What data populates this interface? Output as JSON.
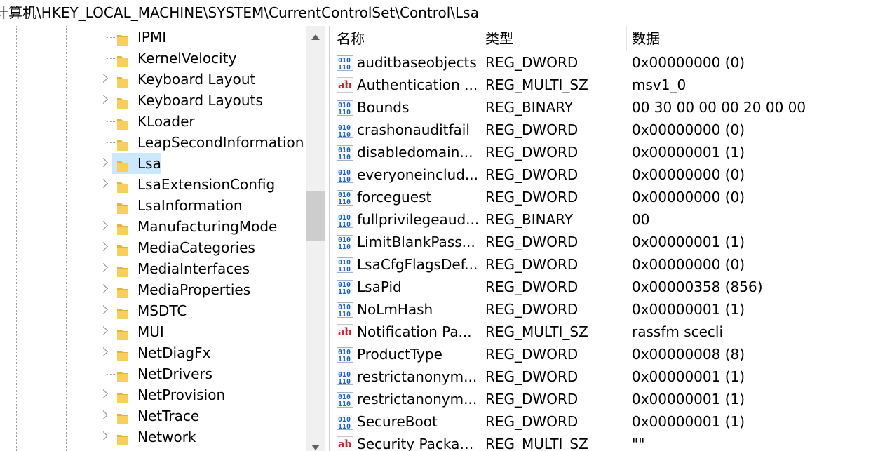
{
  "address": {
    "path": "计算机\\HKEY_LOCAL_MACHINE\\SYSTEM\\CurrentControlSet\\Control\\Lsa"
  },
  "tree": {
    "items": [
      {
        "label": "IPMI",
        "expandable": false,
        "selected": false
      },
      {
        "label": "KernelVelocity",
        "expandable": false,
        "selected": false
      },
      {
        "label": "Keyboard Layout",
        "expandable": true,
        "selected": false
      },
      {
        "label": "Keyboard Layouts",
        "expandable": true,
        "selected": false
      },
      {
        "label": "KLoader",
        "expandable": false,
        "selected": false
      },
      {
        "label": "LeapSecondInformation",
        "expandable": false,
        "selected": false
      },
      {
        "label": "Lsa",
        "expandable": true,
        "selected": true
      },
      {
        "label": "LsaExtensionConfig",
        "expandable": true,
        "selected": false
      },
      {
        "label": "LsaInformation",
        "expandable": false,
        "selected": false
      },
      {
        "label": "ManufacturingMode",
        "expandable": true,
        "selected": false
      },
      {
        "label": "MediaCategories",
        "expandable": true,
        "selected": false
      },
      {
        "label": "MediaInterfaces",
        "expandable": true,
        "selected": false
      },
      {
        "label": "MediaProperties",
        "expandable": true,
        "selected": false
      },
      {
        "label": "MSDTC",
        "expandable": true,
        "selected": false
      },
      {
        "label": "MUI",
        "expandable": true,
        "selected": false
      },
      {
        "label": "NetDiagFx",
        "expandable": true,
        "selected": false
      },
      {
        "label": "NetDrivers",
        "expandable": false,
        "selected": false
      },
      {
        "label": "NetProvision",
        "expandable": true,
        "selected": false
      },
      {
        "label": "NetTrace",
        "expandable": true,
        "selected": false
      },
      {
        "label": "Network",
        "expandable": true,
        "selected": false
      }
    ]
  },
  "list": {
    "columns": [
      "名称",
      "类型",
      "数据"
    ],
    "rows": [
      {
        "icon": "binary-value-icon",
        "name": "auditbaseobjects",
        "type": "REG_DWORD",
        "data": "0x00000000 (0)"
      },
      {
        "icon": "string-value-icon",
        "name": "Authentication ...",
        "type": "REG_MULTI_SZ",
        "data": "msv1_0"
      },
      {
        "icon": "binary-value-icon",
        "name": "Bounds",
        "type": "REG_BINARY",
        "data": "00 30 00 00 00 20 00 00"
      },
      {
        "icon": "binary-value-icon",
        "name": "crashonauditfail",
        "type": "REG_DWORD",
        "data": "0x00000000 (0)"
      },
      {
        "icon": "binary-value-icon",
        "name": "disabledomain...",
        "type": "REG_DWORD",
        "data": "0x00000001 (1)"
      },
      {
        "icon": "binary-value-icon",
        "name": "everyoneinclud...",
        "type": "REG_DWORD",
        "data": "0x00000000 (0)"
      },
      {
        "icon": "binary-value-icon",
        "name": "forceguest",
        "type": "REG_DWORD",
        "data": "0x00000000 (0)"
      },
      {
        "icon": "binary-value-icon",
        "name": "fullprivilegeaud...",
        "type": "REG_BINARY",
        "data": "00"
      },
      {
        "icon": "binary-value-icon",
        "name": "LimitBlankPass...",
        "type": "REG_DWORD",
        "data": "0x00000001 (1)"
      },
      {
        "icon": "binary-value-icon",
        "name": "LsaCfgFlagsDef...",
        "type": "REG_DWORD",
        "data": "0x00000000 (0)"
      },
      {
        "icon": "binary-value-icon",
        "name": "LsaPid",
        "type": "REG_DWORD",
        "data": "0x00000358 (856)"
      },
      {
        "icon": "binary-value-icon",
        "name": "NoLmHash",
        "type": "REG_DWORD",
        "data": "0x00000001 (1)"
      },
      {
        "icon": "string-value-icon",
        "name": "Notification Pa...",
        "type": "REG_MULTI_SZ",
        "data": "rassfm scecli"
      },
      {
        "icon": "binary-value-icon",
        "name": "ProductType",
        "type": "REG_DWORD",
        "data": "0x00000008 (8)"
      },
      {
        "icon": "binary-value-icon",
        "name": "restrictanonym...",
        "type": "REG_DWORD",
        "data": "0x00000001 (1)"
      },
      {
        "icon": "binary-value-icon",
        "name": "restrictanonym...",
        "type": "REG_DWORD",
        "data": "0x00000001 (1)"
      },
      {
        "icon": "binary-value-icon",
        "name": "SecureBoot",
        "type": "REG_DWORD",
        "data": "0x00000001 (1)"
      },
      {
        "icon": "string-value-icon",
        "name": "Security Packag...",
        "type": "REG_MULTI_SZ",
        "data": "\"\""
      }
    ]
  },
  "colors": {
    "selection": "#cce8ff",
    "folder": "#f0c24b",
    "binary_icon": "#1f5fbf",
    "string_icon": "#c1272d"
  }
}
